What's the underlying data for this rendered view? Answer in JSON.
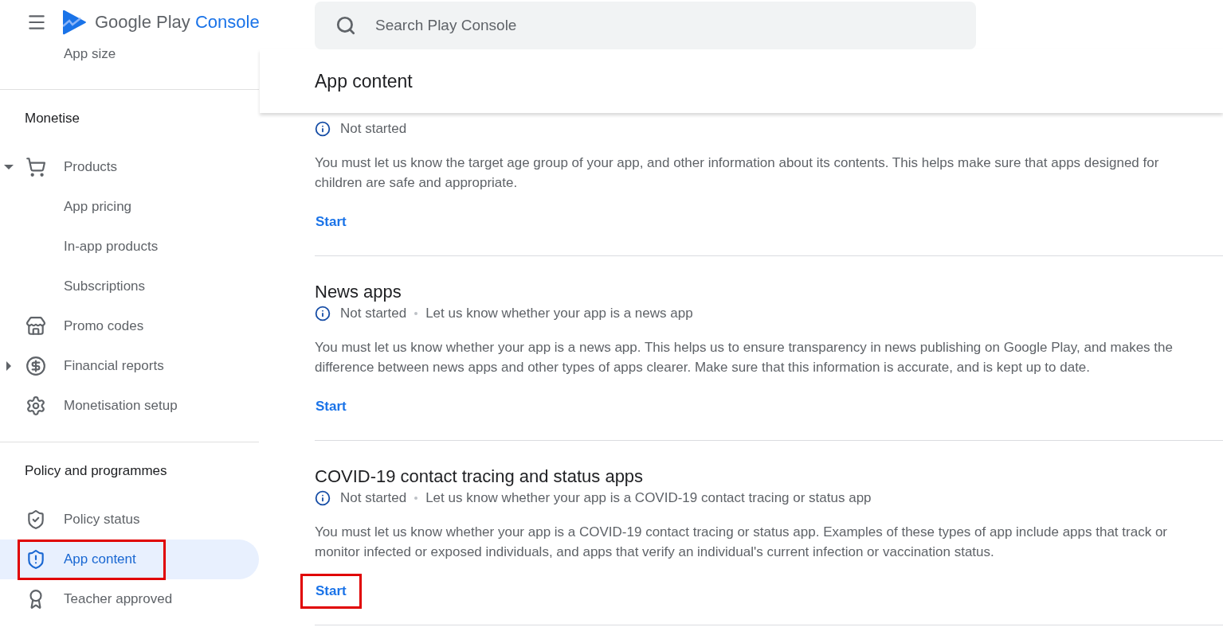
{
  "header": {
    "brand_primary": "Google Play",
    "brand_secondary": "Console"
  },
  "sidebar": {
    "groups": [
      {
        "items": [
          {
            "label": "App size",
            "selected": false,
            "highlighted": false
          }
        ]
      },
      {
        "heading": "Monetise",
        "items": [
          {
            "label": "Products",
            "expanded": true,
            "selected": false,
            "highlighted": false
          },
          {
            "label": "App pricing",
            "selected": false,
            "highlighted": false
          },
          {
            "label": "In-app products",
            "selected": false,
            "highlighted": false
          },
          {
            "label": "Subscriptions",
            "selected": false,
            "highlighted": false
          },
          {
            "label": "Promo codes",
            "selected": false,
            "highlighted": false
          },
          {
            "label": "Financial reports",
            "expanded": false,
            "selected": false,
            "highlighted": false
          },
          {
            "label": "Monetisation setup",
            "selected": false,
            "highlighted": false
          }
        ]
      },
      {
        "heading": "Policy and programmes",
        "items": [
          {
            "label": "Policy status",
            "selected": false,
            "highlighted": false
          },
          {
            "label": "App content",
            "selected": true,
            "highlighted": true
          },
          {
            "label": "Teacher approved",
            "selected": false,
            "highlighted": false
          }
        ]
      }
    ]
  },
  "search": {
    "placeholder": "Search Play Console"
  },
  "page_title": "App content",
  "sections": [
    {
      "status": "Not started",
      "description": "You must let us know the target age group of your app, and other information about its contents. This helps make sure that apps designed for children are safe and appropriate.",
      "action": "Start",
      "highlighted": false
    },
    {
      "title": "News apps",
      "status": "Not started",
      "summary": "Let us know whether your app is a news app",
      "description": "You must let us know whether your app is a news app. This helps us to ensure transparency in news publishing on Google Play, and makes the difference between news apps and other types of apps clearer. Make sure that this information is accurate, and is kept up to date.",
      "action": "Start",
      "highlighted": false
    },
    {
      "title": "COVID-19 contact tracing and status apps",
      "status": "Not started",
      "summary": "Let us know whether your app is a COVID-19 contact tracing or status app",
      "description": "You must let us know whether your app is a COVID-19 contact tracing or status app. Examples of these types of app include apps that track or monitor infected or exposed individuals, and apps that verify an individual's current infection or vaccination status.",
      "action": "Start",
      "highlighted": true
    }
  ]
}
